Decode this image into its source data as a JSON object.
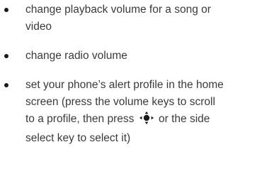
{
  "bullets": [
    {
      "text": "change playback volume for a song or video"
    },
    {
      "text": "change radio volume"
    },
    {
      "text_before_icon": "set your phone’s alert profile in the home screen (press the volume keys to scroll to a profile, then press",
      "icon": "navigation-key-icon",
      "text_after_icon": "or the side select key to select it)"
    }
  ]
}
